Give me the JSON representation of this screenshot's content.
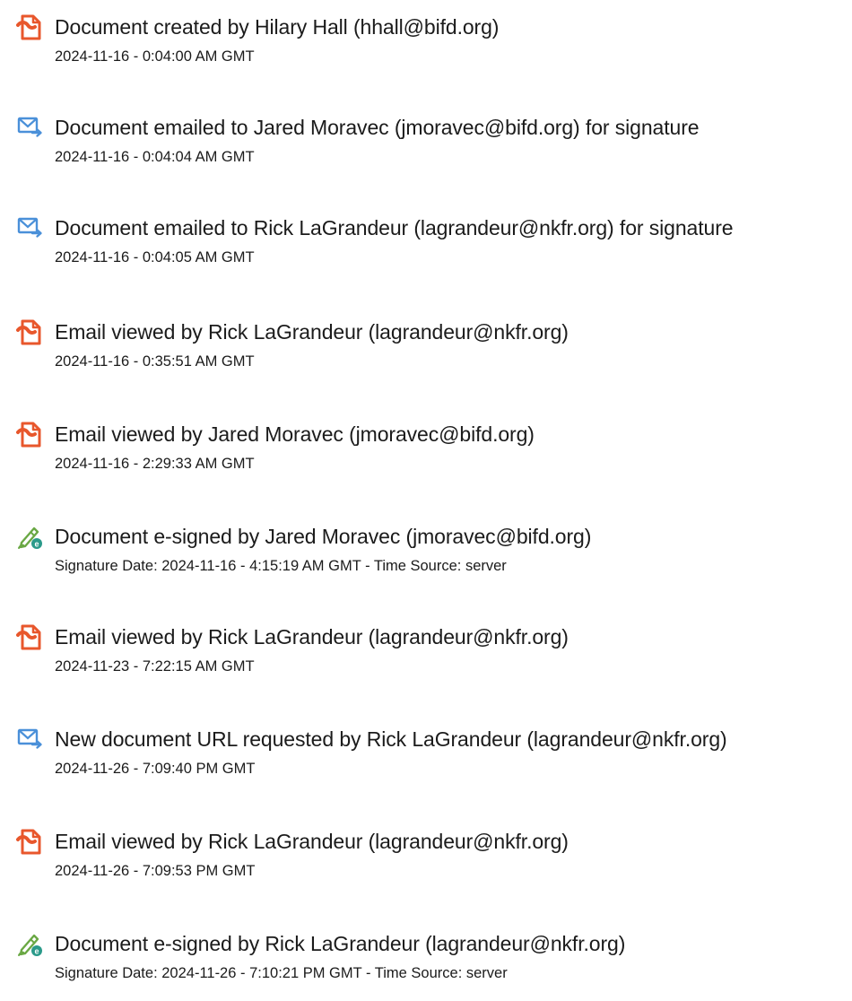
{
  "colors": {
    "text": "#1b1b1b",
    "pdf_icon": "#e8572c",
    "mail_icon": "#4a90d9",
    "sign_icon_pen": "#6aa844",
    "sign_icon_badge": "#2b9a8a"
  },
  "entries": [
    {
      "icon": "document-created-icon",
      "title": "Document created by Hilary Hall (hhall@bifd.org)",
      "sub": "2024-11-16 - 0:04:00 AM GMT"
    },
    {
      "icon": "email-sent-icon",
      "title": "Document emailed to Jared Moravec (jmoravec@bifd.org) for signature",
      "sub": "2024-11-16 - 0:04:04 AM GMT"
    },
    {
      "icon": "email-sent-icon",
      "title": "Document emailed to Rick LaGrandeur (lagrandeur@nkfr.org) for signature",
      "sub": "2024-11-16 - 0:04:05 AM GMT"
    },
    {
      "icon": "document-viewed-icon",
      "title": "Email viewed by Rick LaGrandeur (lagrandeur@nkfr.org)",
      "sub": "2024-11-16 - 0:35:51 AM GMT"
    },
    {
      "icon": "document-viewed-icon",
      "title": "Email viewed by Jared Moravec (jmoravec@bifd.org)",
      "sub": "2024-11-16 - 2:29:33 AM GMT"
    },
    {
      "icon": "e-sign-icon",
      "title": "Document e-signed by Jared Moravec (jmoravec@bifd.org)",
      "sub": "Signature Date: 2024-11-16 - 4:15:19 AM GMT - Time Source: server"
    },
    {
      "icon": "document-viewed-icon",
      "title": "Email viewed by Rick LaGrandeur (lagrandeur@nkfr.org)",
      "sub": "2024-11-23 - 7:22:15 AM GMT"
    },
    {
      "icon": "email-sent-icon",
      "title": "New document URL requested by Rick LaGrandeur (lagrandeur@nkfr.org)",
      "sub": "2024-11-26 - 7:09:40 PM GMT"
    },
    {
      "icon": "document-viewed-icon",
      "title": "Email viewed by Rick LaGrandeur (lagrandeur@nkfr.org)",
      "sub": "2024-11-26 - 7:09:53 PM GMT"
    },
    {
      "icon": "e-sign-icon",
      "title": "Document e-signed by Rick LaGrandeur (lagrandeur@nkfr.org)",
      "sub": "Signature Date: 2024-11-26 - 7:10:21 PM GMT - Time Source: server"
    }
  ]
}
